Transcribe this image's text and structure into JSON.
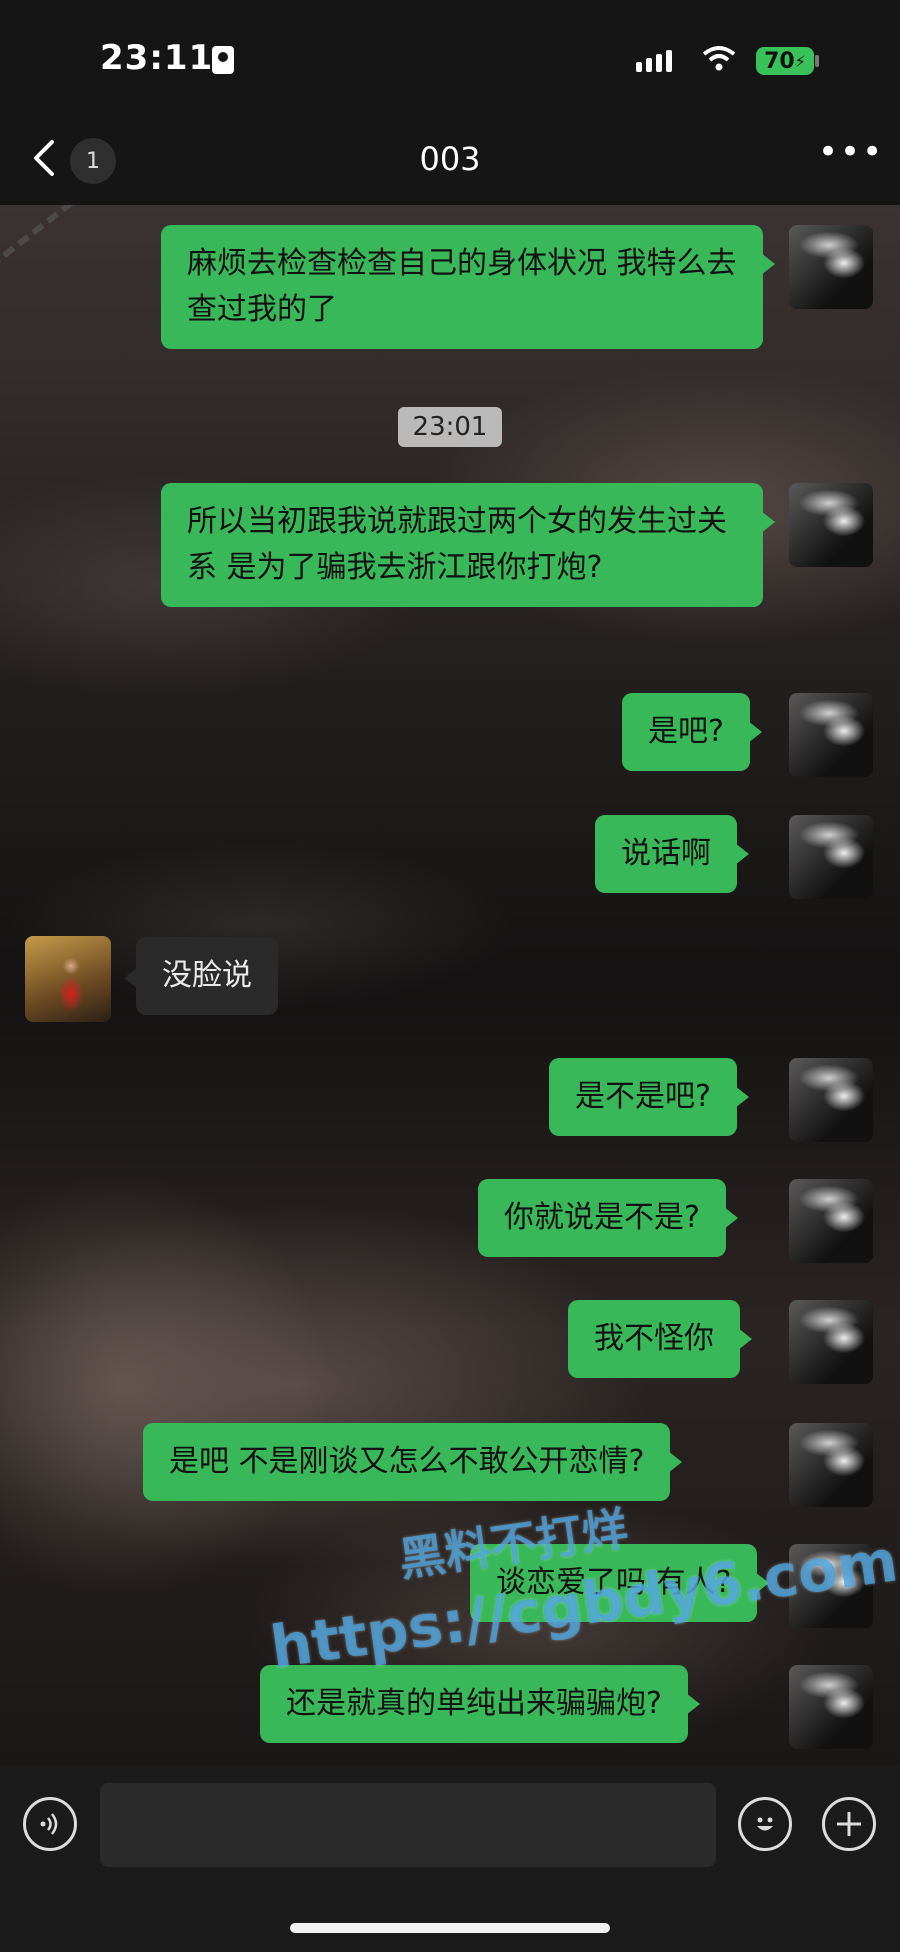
{
  "status_bar": {
    "time": "23:11",
    "battery": "70"
  },
  "header": {
    "back_badge": "1",
    "title": "003",
    "more": "•••"
  },
  "timestamp": "23:01",
  "messages": [
    {
      "from": "me",
      "text": "麻烦去检查检查自己的身体状况 我特么去查过我的了"
    },
    {
      "from": "me",
      "text": "所以当初跟我说就跟过两个女的发生过关系 是为了骗我去浙江跟你打炮?"
    },
    {
      "from": "me",
      "text": "是吧?"
    },
    {
      "from": "me",
      "text": "说话啊"
    },
    {
      "from": "them",
      "text": "没脸说"
    },
    {
      "from": "me",
      "text": "是不是吧?"
    },
    {
      "from": "me",
      "text": "你就说是不是?"
    },
    {
      "from": "me",
      "text": "我不怪你"
    },
    {
      "from": "me",
      "text": "是吧 不是刚谈又怎么不敢公开恋情?"
    },
    {
      "from": "me",
      "text": "谈恋爱了吗 有人?"
    },
    {
      "from": "me",
      "text": "还是就真的单纯出来骗骗炮?"
    }
  ],
  "watermark": {
    "line1": "黑料不打烊",
    "line2": "https://cgbdy6.com"
  },
  "icons": {
    "back": "chevron-left-icon",
    "more": "more-icon",
    "voice": "voice-icon",
    "emoji": "emoji-icon",
    "plus": "plus-icon"
  },
  "colors": {
    "my_bubble": "#39b85a",
    "their_bubble": "#2a2a2a",
    "battery": "#39c25a"
  }
}
